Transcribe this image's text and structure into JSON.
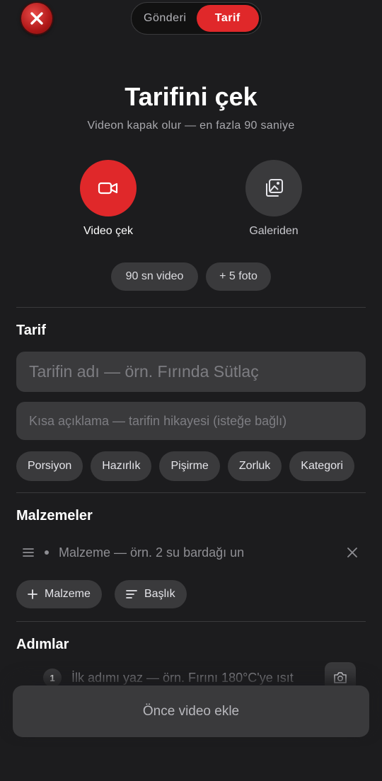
{
  "header": {
    "close_icon": "close-icon",
    "tabs": [
      {
        "label": "Gönderi",
        "active": false
      },
      {
        "label": "Tarif",
        "active": true
      }
    ]
  },
  "hero": {
    "title": "Tarifini çek",
    "subtitle": "Videon kapak olur — en fazla 90 saniye"
  },
  "capture": {
    "video_label": "Video çek",
    "video_icon": "video-camera-icon",
    "gallery_label": "Galeriden",
    "gallery_icon": "gallery-icon"
  },
  "limits": [
    "90 sn video",
    "+ 5 foto"
  ],
  "recipe": {
    "section_title": "Tarif",
    "name_placeholder": "Tarifin adı — örn. Fırında Sütlaç",
    "desc_placeholder": "Kısa açıklama — tarifin hikayesi (isteğe bağlı)",
    "chips": [
      "Porsiyon",
      "Hazırlık",
      "Pişirme",
      "Zorluk",
      "Kategori"
    ]
  },
  "ingredients": {
    "section_title": "Malzemeler",
    "placeholder": "Malzeme — örn. 2 su bardağı un",
    "add_button": "Malzeme",
    "heading_button": "Başlık"
  },
  "steps": {
    "section_title": "Adımlar",
    "first_number": "1",
    "placeholder": "İlk adımı yaz — örn. Fırını 180°C'ye ısıt"
  },
  "footer": {
    "primary_button": "Önce video ekle"
  },
  "colors": {
    "accent": "#e0282a",
    "background": "#1c1c1e",
    "surface": "#3a3a3c"
  }
}
